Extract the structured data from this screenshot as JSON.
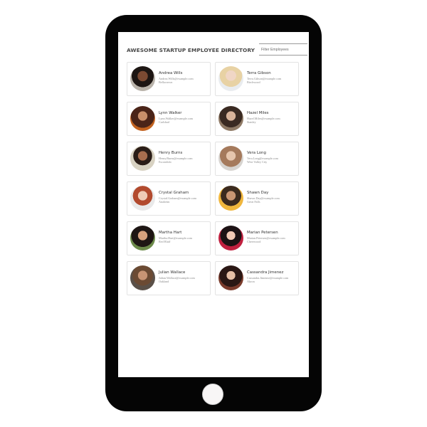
{
  "page": {
    "title": "AWESOME STARTUP EMPLOYEE DIRECTORY",
    "filter_placeholder": "Filter Employees"
  },
  "employees": [
    {
      "name": "Andrea Wills",
      "email": "Andrea.Wills@example.com",
      "city": "Bellacrown",
      "avatar": "avatar-photo"
    },
    {
      "name": "Terra Gibson",
      "email": "Terra.Gibson@example.com",
      "city": "Birchwood",
      "avatar": "avatar-photo"
    },
    {
      "name": "Lynn Walker",
      "email": "Lynn.Walker@example.com",
      "city": "Carlsbad",
      "avatar": "avatar-photo"
    },
    {
      "name": "Hazel Miles",
      "email": "Hazel.Miles@example.com",
      "city": "Stanley",
      "avatar": "avatar-photo"
    },
    {
      "name": "Henry Burns",
      "email": "Henry.Burns@example.com",
      "city": "Escondido",
      "avatar": "avatar-photo"
    },
    {
      "name": "Vera Long",
      "email": "Vera.Long@example.com",
      "city": "West Valley City",
      "avatar": "avatar-photo"
    },
    {
      "name": "Crystal Graham",
      "email": "Crystal.Graham@example.com",
      "city": "Anaheim",
      "avatar": "avatar-photo"
    },
    {
      "name": "Shawn Day",
      "email": "Shawn.Day@example.com",
      "city": "Great Falls",
      "avatar": "avatar-photo"
    },
    {
      "name": "Martha Hart",
      "email": "Martha.Hart@example.com",
      "city": "Red Bluff",
      "avatar": "avatar-photo"
    },
    {
      "name": "Marian Petersen",
      "email": "Marian.Petersen@example.com",
      "city": "Cheerwood",
      "avatar": "avatar-photo"
    },
    {
      "name": "Julian Wallace",
      "email": "Julian.Wallace@example.com",
      "city": "Oakland",
      "avatar": "avatar-photo"
    },
    {
      "name": "Cassandra Jimenez",
      "email": "Cassandra.Jimenez@example.com",
      "city": "Akron",
      "avatar": "avatar-photo"
    }
  ],
  "colors": {
    "device": "#050505",
    "screen": "#ffffff",
    "card_border": "#e3e3e3",
    "title_text": "#4a4a4a"
  }
}
